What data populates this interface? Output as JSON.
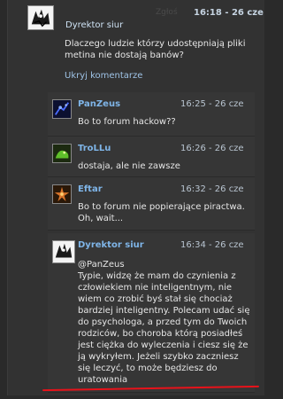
{
  "root": {
    "author": "Dyrektor siur",
    "report_label": "Zgłoś",
    "time": "16:18 - 26 cze",
    "text": "Dlaczego ludzie którzy udostępniają pliki metina nie dostają banów?",
    "toggle_label": "Ukryj komentarze"
  },
  "replies": [
    {
      "author": "PanZeus",
      "time": "16:25 - 26 cze",
      "text": "Bo to forum hackow??"
    },
    {
      "author": "TroLLu",
      "time": "16:26 - 26 cze",
      "text": "dostaja, ale nie zawsze"
    },
    {
      "author": "Eftar",
      "time": "16:32 - 26 cze",
      "text": "Bo to forum nie popierające piractwa. Oh, wait..."
    },
    {
      "author": "Dyrektor siur",
      "time": "16:34 - 26 cze",
      "mention": "@PanZeus",
      "text": "Typie, widzę że mam do czynienia z człowiekiem nie inteligentnym, nie wiem co zrobić byś stał się chociaż bardziej inteligentny. Polecam udać się do psychologa, a przed tym do Twoich rodziców, bo choroba którą posiadłeś jest ciężka do wyleczenia i ciesz się że ją wykryłem. Jeżeli szybko zaczniesz się leczyć, to może będziesz do uratowania"
    }
  ],
  "colors": {
    "accent_link": "#9fc3e6",
    "author_name": "#7fb5e8",
    "annotation_underline": "#e8121a"
  },
  "icons": [
    "ink-portrait-avatar",
    "nebula-avatar",
    "green-creature-avatar",
    "fire-star-avatar"
  ]
}
